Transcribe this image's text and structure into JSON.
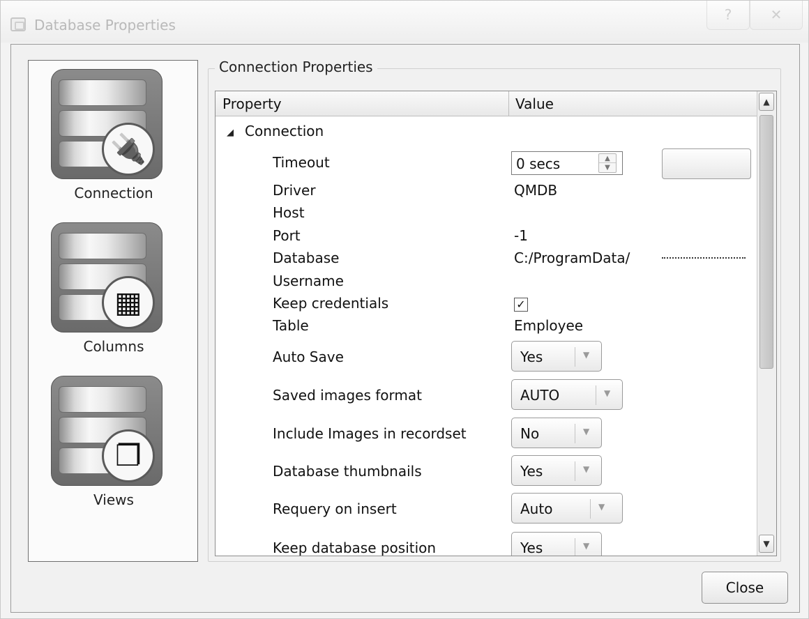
{
  "window": {
    "title": "Database Properties",
    "help_glyph": "?",
    "close_glyph": "✕"
  },
  "sidebar": {
    "items": [
      {
        "label": "Connection",
        "icon": "plug-icon",
        "glyph": "🔌"
      },
      {
        "label": "Columns",
        "icon": "columns-grid-icon",
        "glyph": "▦"
      },
      {
        "label": "Views",
        "icon": "views-stack-icon",
        "glyph": "❐"
      }
    ]
  },
  "group": {
    "title": "Connection Properties"
  },
  "grid": {
    "col_property": "Property",
    "col_value": "Value",
    "section": "Connection",
    "section_arrow": "◢",
    "rows": {
      "timeout": {
        "label": "Timeout",
        "value": "0 secs"
      },
      "driver": {
        "label": "Driver",
        "value": "QMDB"
      },
      "host": {
        "label": "Host",
        "value": ""
      },
      "port": {
        "label": "Port",
        "value": "-1"
      },
      "database": {
        "label": "Database",
        "value": "C:/ProgramData/"
      },
      "username": {
        "label": "Username",
        "value": ""
      },
      "keep_credentials": {
        "label": "Keep credentials",
        "checked": true,
        "check_glyph": "✓"
      },
      "table": {
        "label": "Table",
        "value": "Employee"
      },
      "auto_save": {
        "label": "Auto Save",
        "value": "Yes"
      },
      "saved_images_format": {
        "label": "Saved images format",
        "value": "AUTO"
      },
      "include_images": {
        "label": "Include Images in recordset",
        "value": "No"
      },
      "database_thumbnails": {
        "label": "Database thumbnails",
        "value": "Yes"
      },
      "requery_on_insert": {
        "label": "Requery on insert",
        "value": "Auto"
      },
      "keep_database_position": {
        "label": "Keep database position",
        "value": "Yes"
      }
    }
  },
  "buttons": {
    "close": "Close"
  },
  "glyphs": {
    "scroll_up": "▲",
    "scroll_down": "▼",
    "spin_up": "▲",
    "spin_down": "▼",
    "dropdown": "▼"
  }
}
